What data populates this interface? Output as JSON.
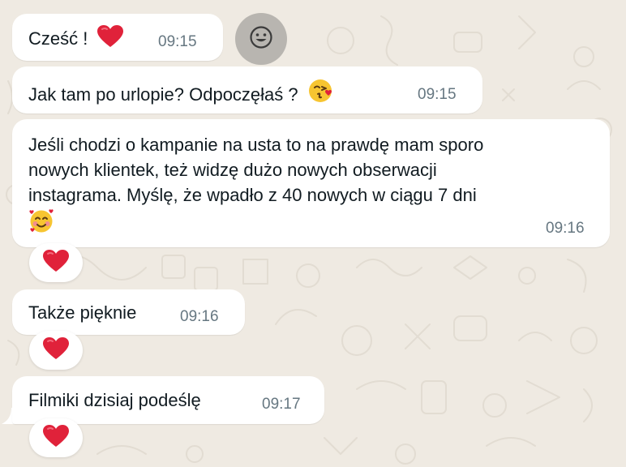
{
  "chat": {
    "messages": [
      {
        "text": "Cześć !",
        "time": "09:15",
        "emoji": "red-heart"
      },
      {
        "text": "Jak tam po urlopie? Odpoczęłaś ?",
        "time": "09:15",
        "emoji": "face-blowing-kiss"
      },
      {
        "lines": [
          "Jeśli chodzi o kampanie na usta to na prawdę mam sporo",
          "nowych klientek, też widzę dużo nowych obserwacji",
          "instagrama. Myślę, że wpadło z 40 nowych w ciągu 7 dni"
        ],
        "time": "09:16",
        "emoji": "smiling-face-with-hearts",
        "reaction": "red-heart"
      },
      {
        "text": "Także pięknie",
        "time": "09:16",
        "reaction": "red-heart"
      },
      {
        "text": "Filmiki dzisiaj podeślę",
        "time": "09:17",
        "reaction": "red-heart"
      }
    ]
  },
  "colors": {
    "background": "#efeae2",
    "bubble": "#ffffff",
    "text": "#111b21",
    "timestamp": "#667781",
    "heart": "#e0223a",
    "emoji_button": "#b8b5b0"
  },
  "icons": {
    "emoji_picker": "smiley-icon"
  }
}
